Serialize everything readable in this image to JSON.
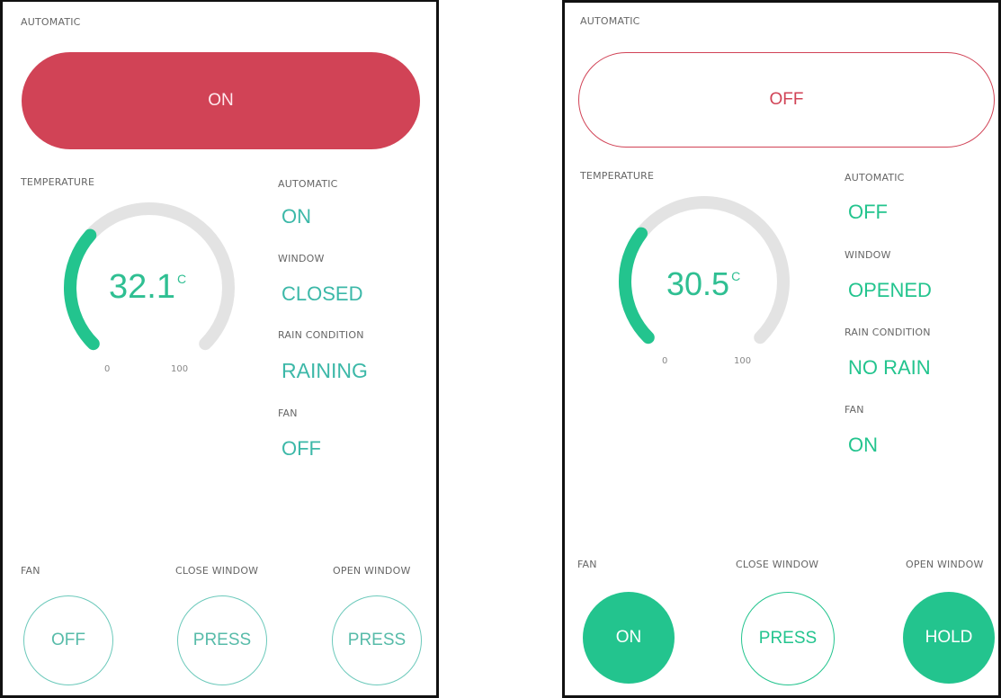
{
  "accent": "#23c48e",
  "danger": "#d14356",
  "panels": [
    {
      "automatic_label": "AUTOMATIC",
      "automatic_button": "ON",
      "automatic_state": "on",
      "temperature_label": "TEMPERATURE",
      "gauge": {
        "value": "32.1",
        "unit": "C",
        "min": "0",
        "max": "100",
        "fraction": 0.321
      },
      "status": [
        {
          "label": "AUTOMATIC",
          "value": "ON"
        },
        {
          "label": "WINDOW",
          "value": "CLOSED"
        },
        {
          "label": "RAIN CONDITION",
          "value": "RAINING"
        },
        {
          "label": "FAN",
          "value": "OFF"
        }
      ],
      "controls": [
        {
          "label": "FAN",
          "button": "OFF",
          "style": "outline"
        },
        {
          "label": "CLOSE WINDOW",
          "button": "PRESS",
          "style": "outline"
        },
        {
          "label": "OPEN WINDOW",
          "button": "PRESS",
          "style": "outline"
        }
      ]
    },
    {
      "automatic_label": "AUTOMATIC",
      "automatic_button": "OFF",
      "automatic_state": "off",
      "temperature_label": "TEMPERATURE",
      "gauge": {
        "value": "30.5",
        "unit": "C",
        "min": "0",
        "max": "100",
        "fraction": 0.305
      },
      "status": [
        {
          "label": "AUTOMATIC",
          "value": "OFF"
        },
        {
          "label": "WINDOW",
          "value": "OPENED"
        },
        {
          "label": "RAIN CONDITION",
          "value": "NO RAIN"
        },
        {
          "label": "FAN",
          "value": "ON"
        }
      ],
      "controls": [
        {
          "label": "FAN",
          "button": "ON",
          "style": "filled"
        },
        {
          "label": "CLOSE WINDOW",
          "button": "PRESS",
          "style": "outline"
        },
        {
          "label": "OPEN WINDOW",
          "button": "HOLD",
          "style": "filled"
        }
      ]
    }
  ]
}
